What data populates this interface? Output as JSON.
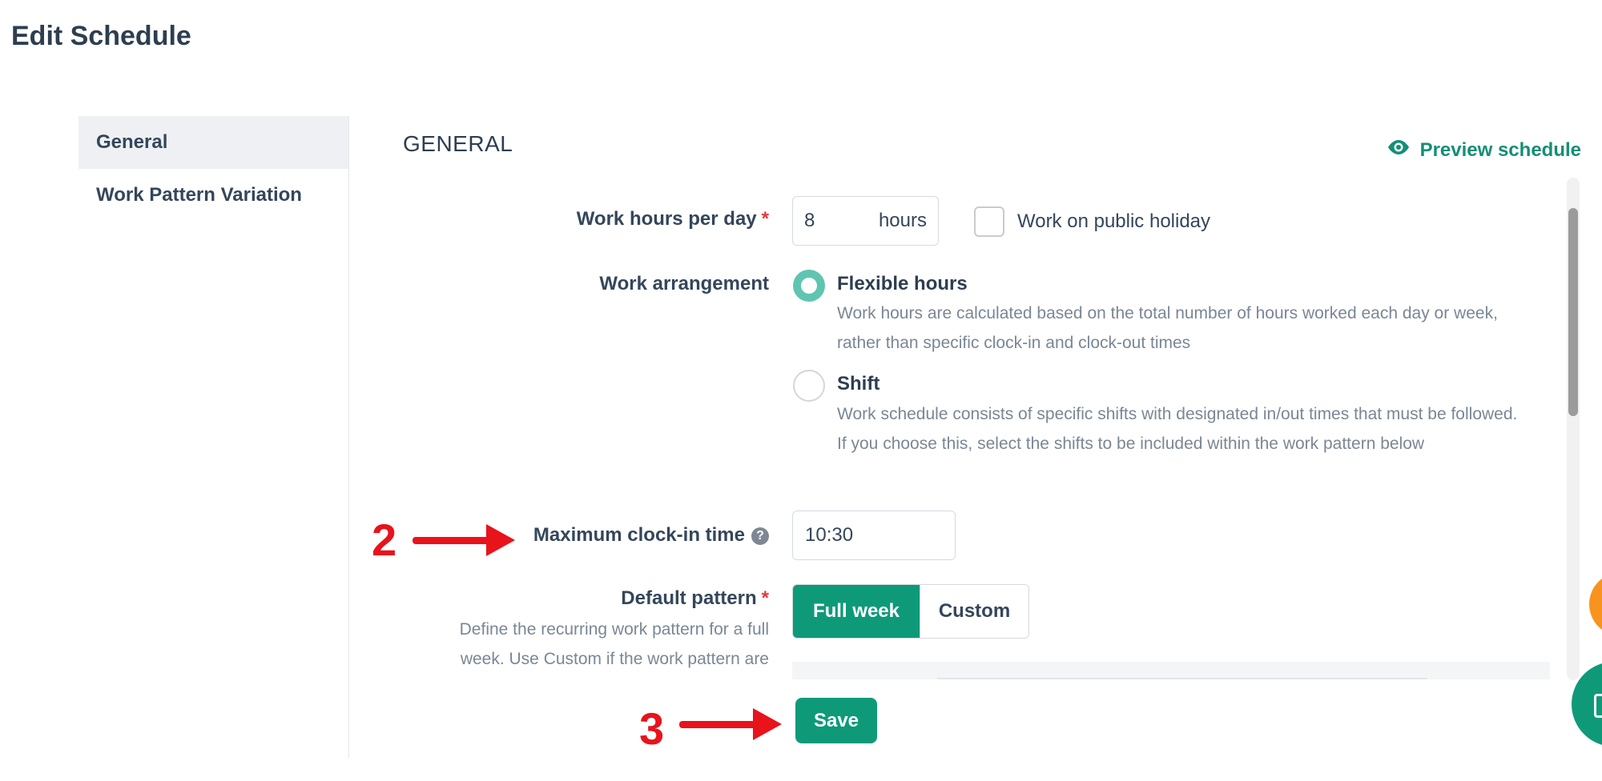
{
  "page": {
    "title": "Edit Schedule"
  },
  "sidebar": {
    "items": [
      {
        "label": "General",
        "active": true
      },
      {
        "label": "Work Pattern Variation",
        "active": false
      }
    ]
  },
  "section": {
    "title": "GENERAL",
    "preview_label": "Preview schedule",
    "preview_icon": "eye-icon"
  },
  "form": {
    "work_hours": {
      "label": "Work hours per day",
      "required_mark": "*",
      "value": "8",
      "unit": "hours"
    },
    "public_holiday": {
      "label": "Work on public holiday",
      "checked": false
    },
    "work_arrangement": {
      "label": "Work arrangement",
      "options": [
        {
          "title": "Flexible hours",
          "description": "Work hours are calculated based on the total number of hours worked each day or week, rather than specific clock-in and clock-out times",
          "selected": true
        },
        {
          "title": "Shift",
          "description": "Work schedule consists of specific shifts with designated in/out times that must be followed. If you choose this, select the shifts to be included within the work pattern below",
          "selected": false
        }
      ]
    },
    "max_clock_in": {
      "label": "Maximum clock-in time",
      "help_icon": "?",
      "value": "10:30"
    },
    "default_pattern": {
      "label": "Default pattern",
      "required_mark": "*",
      "description": "Define the recurring work pattern for a full week. Use Custom if the work pattern are",
      "options": [
        "Full week",
        "Custom"
      ],
      "selected": "Full week"
    },
    "save_label": "Save"
  },
  "annotations": {
    "step_2": "2",
    "step_3": "3",
    "color": "#e8131b"
  },
  "colors": {
    "accent": "#0e9a79",
    "required": "#e23a3a",
    "text": "#34465a",
    "muted": "#7a8794"
  }
}
